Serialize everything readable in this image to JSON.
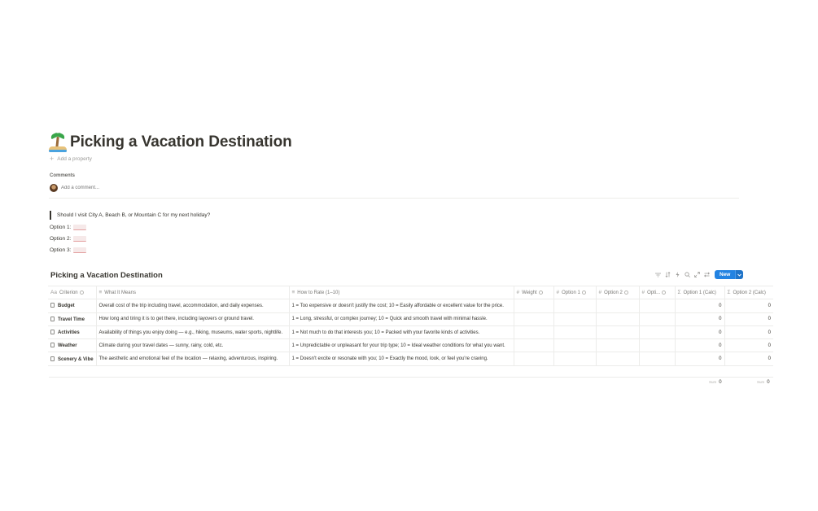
{
  "page": {
    "icon": "desert-island-icon",
    "title": "Picking a Vacation Destination",
    "add_property": "Add a property",
    "comments_label": "Comments",
    "comment_placeholder": "Add a comment..."
  },
  "body": {
    "question": "Should I visit City A, Beach B, or Mountain C for my next holiday?",
    "options": [
      "Option 1:",
      "Option 2:",
      "Option 3:"
    ]
  },
  "database": {
    "title": "Picking a Vacation Destination",
    "toolbar_icons": [
      "filter-icon",
      "sort-icon",
      "lightning-icon",
      "search-icon",
      "expand-icon",
      "more-icon"
    ],
    "new_button": "New",
    "columns": [
      "Criterion",
      "What It Means",
      "How to Rate (1–10)",
      "Weight",
      "Option 1",
      "Option 2",
      "Opti...",
      "Option 1 (Calc)",
      "Option 2 (Calc)"
    ],
    "rows": [
      {
        "criterion": "Budget",
        "meaning": "Overall cost of the trip including travel, accommodation, and daily expenses.",
        "rate": "1 = Too expensive or doesn't justify the cost; 10 = Easily affordable or excellent value for the price.",
        "calc1": "0",
        "calc2": "0"
      },
      {
        "criterion": "Travel Time",
        "meaning": "How long and tiring it is to get there, including layovers or ground travel.",
        "rate": "1 = Long, stressful, or complex journey; 10 = Quick and smooth travel with minimal hassle.",
        "calc1": "0",
        "calc2": "0"
      },
      {
        "criterion": "Activities",
        "meaning": "Availability of things you enjoy doing — e.g., hiking, museums, water sports, nightlife.",
        "rate": "1 = Not much to do that interests you; 10 = Packed with your favorite kinds of activities.",
        "calc1": "0",
        "calc2": "0"
      },
      {
        "criterion": "Weather",
        "meaning": "Climate during your travel dates — sunny, rainy, cold, etc.",
        "rate": "1 = Unpredictable or unpleasant for your trip type; 10 = Ideal weather conditions for what you want.",
        "calc1": "0",
        "calc2": "0"
      },
      {
        "criterion": "Scenery & Vibe",
        "meaning": "The aesthetic and emotional feel of the location — relaxing, adventurous, inspiring.",
        "rate": "1 = Doesn't excite or resonate with you; 10 = Exactly the mood, look, or feel you're craving.",
        "calc1": "0",
        "calc2": "0"
      }
    ],
    "footer": {
      "sum_label": "Sum",
      "sum1": "0",
      "sum2": "0"
    }
  }
}
